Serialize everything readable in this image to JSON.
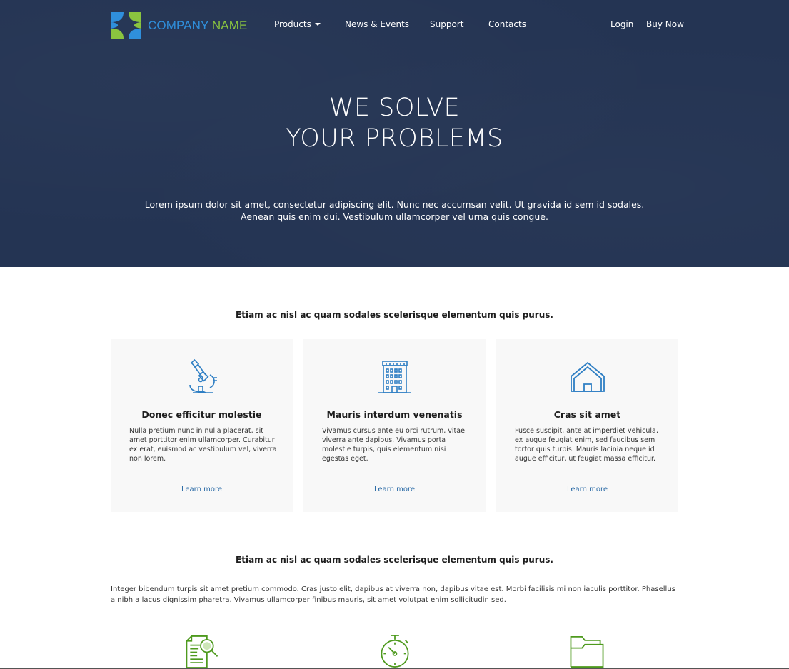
{
  "header": {
    "logo": {
      "text_part1": "COMPANY",
      "text_part2": "NAME",
      "icon": "logo-mark-icon",
      "colors": {
        "blue": "#2f8fdc",
        "green": "#8ac43f"
      }
    },
    "nav": [
      {
        "label": "Products",
        "has_dropdown": true
      },
      {
        "label": "News & Events"
      },
      {
        "label": "Support"
      },
      {
        "label": "Contacts"
      }
    ],
    "login_label": "Login",
    "buy_label": "Buy Now"
  },
  "hero": {
    "title_line1": "WE SOLVE",
    "title_line2": "YOUR PROBLEMS",
    "text_line1": "Lorem ipsum dolor sit amet, consectetur adipiscing elit. Nunc nec accumsan velit. Ut gravida id sem id sodales.",
    "text_line2": "Aenean quis enim dui. Vestibulum ullamcorper vel urna quis congue.",
    "background": "#243453"
  },
  "features": {
    "heading": "Etiam ac nisl ac quam sodales scelerisque elementum quis purus.",
    "cards": [
      {
        "icon": "microscope-icon",
        "title": "Donec efficitur molestie",
        "text": "Nulla pretium nunc in nulla placerat, sit amet porttitor enim ullamcorper. Curabitur ex erat, euismod ac vestibulum vel, viverra non lorem.",
        "link": "Learn more"
      },
      {
        "icon": "building-icon",
        "title": "Mauris interdum venenatis",
        "text": "Vivamus cursus ante eu orci rutrum, vitae viverra ante dapibus. Vivamus porta molestie turpis, quis elementum nisi egestas eget.",
        "link": "Learn more"
      },
      {
        "icon": "house-icon",
        "title": "Cras sit amet",
        "text": "Fusce suscipit, ante at imperdiet vehicula, ex augue feugiat enim, sed faucibus sem tortor quis turpis. Mauris lacinia neque id augue efficitur, ut feugiat massa efficitur.",
        "link": "Learn more"
      }
    ],
    "icon_color": "#2f7fc4"
  },
  "section2": {
    "heading": "Etiam ac nisl ac quam sodales scelerisque elementum quis purus.",
    "paragraph": "Integer bibendum turpis sit amet pretium commodo. Cras justo elit, dapibus at viverra non, dapibus vitae est. Morbi facilisis mi non iaculis porttitor. Phasellus a nibh a lacus dignissim pharetra. Vivamus ullamcorper finibus mauris, sit amet volutpat enim sollicitudin sed.",
    "icons": [
      "document-search-icon",
      "stopwatch-icon",
      "folder-icon"
    ],
    "icon_color": "#4e9a1e"
  }
}
